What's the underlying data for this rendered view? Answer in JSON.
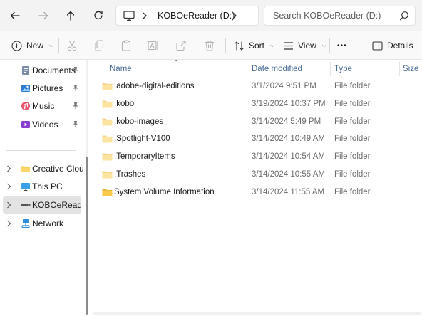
{
  "nav": {
    "back_icon": "arrow-left-icon",
    "forward_icon": "arrow-right-icon",
    "up_icon": "arrow-up-icon",
    "refresh_icon": "refresh-icon"
  },
  "address": {
    "pc_icon": "monitor-icon",
    "path": "KOBOeReader (D:)"
  },
  "search": {
    "placeholder": "Search KOBOeReader (D:)"
  },
  "toolbar": {
    "new_label": "New",
    "sort_label": "Sort",
    "view_label": "View",
    "more_label": "•••",
    "details_label": "Details"
  },
  "sidebar": {
    "quick_access": [
      {
        "label": "Documents",
        "icon": "documents-icon",
        "pinned": true
      },
      {
        "label": "Pictures",
        "icon": "pictures-icon",
        "pinned": true
      },
      {
        "label": "Music",
        "icon": "music-icon",
        "pinned": true
      },
      {
        "label": "Videos",
        "icon": "videos-icon",
        "pinned": true
      }
    ],
    "tree": [
      {
        "label": "Creative Cloud F",
        "icon": "folder-icon"
      },
      {
        "label": "This PC",
        "icon": "monitor-icon"
      },
      {
        "label": "KOBOeReader (D",
        "icon": "drive-icon",
        "selected": true
      },
      {
        "label": "Network",
        "icon": "network-icon"
      }
    ]
  },
  "columns": {
    "name": "Name",
    "date": "Date modified",
    "type": "Type",
    "size": "Size"
  },
  "files": [
    {
      "name": ".adobe-digital-editions",
      "date": "3/1/2024 9:51 PM",
      "type": "File folder",
      "hidden": true
    },
    {
      "name": ".kobo",
      "date": "3/19/2024 10:37 PM",
      "type": "File folder",
      "hidden": true
    },
    {
      "name": ".kobo-images",
      "date": "3/14/2024 5:49 PM",
      "type": "File folder",
      "hidden": true
    },
    {
      "name": ".Spotlight-V100",
      "date": "3/14/2024 10:49 AM",
      "type": "File folder",
      "hidden": true
    },
    {
      "name": ".TemporaryItems",
      "date": "3/14/2024 10:54 AM",
      "type": "File folder",
      "hidden": true
    },
    {
      "name": ".Trashes",
      "date": "3/14/2024 10:55 AM",
      "type": "File folder",
      "hidden": true
    },
    {
      "name": "System Volume Information",
      "date": "3/14/2024 11:55 AM",
      "type": "File folder",
      "hidden": false
    }
  ],
  "colors": {
    "folder": "#f8c94a",
    "folder_hidden": "#fbe3a0",
    "header_text": "#4a6b99",
    "selected_bg": "#e3e3e3"
  }
}
